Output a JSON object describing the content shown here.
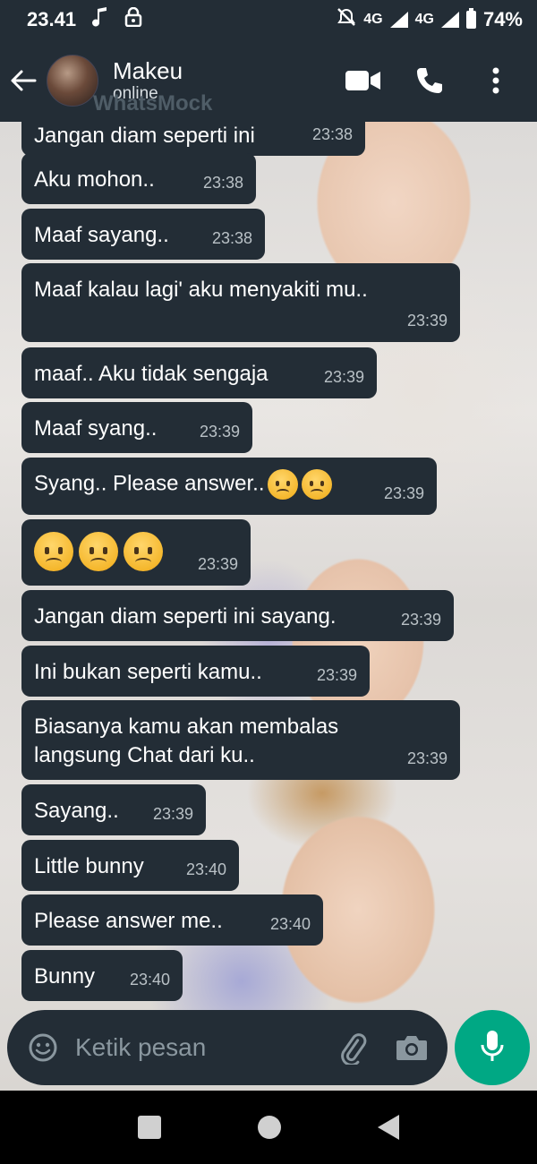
{
  "status_bar": {
    "time": "23.41",
    "network_1": "4G",
    "network_2": "4G",
    "network_2_sup": "4G",
    "battery": "74%",
    "icons": [
      "music-note-icon",
      "lock-icon",
      "mute-icon",
      "signal-icon",
      "battery-icon"
    ]
  },
  "header": {
    "contact_name": "Makeu",
    "contact_status": "online",
    "watermark": "WhatsMock",
    "icons": [
      "back-arrow-icon",
      "video-call-icon",
      "phone-call-icon",
      "more-vertical-icon"
    ]
  },
  "messages": [
    {
      "text": "Jangan diam seperti ini",
      "time": "23:38"
    },
    {
      "text": "Aku mohon..",
      "time": "23:38"
    },
    {
      "text": "Maaf sayang..",
      "time": "23:38"
    },
    {
      "text": "Maaf kalau lagi' aku menyakiti mu..",
      "time": "23:39"
    },
    {
      "text": "maaf.. Aku tidak sengaja",
      "time": "23:39"
    },
    {
      "text": "Maaf syang..",
      "time": "23:39"
    },
    {
      "text": "Syang.. Please answer..",
      "time": "23:39",
      "emoji_count": 2,
      "emoji": "worried-face-emoji"
    },
    {
      "text": "",
      "time": "23:39",
      "emoji_count": 3,
      "emoji": "worried-face-emoji"
    },
    {
      "text": "Jangan diam seperti ini sayang.",
      "time": "23:39"
    },
    {
      "text": "Ini bukan seperti kamu..",
      "time": "23:39"
    },
    {
      "text": "Biasanya kamu akan membalas langsung Chat dari ku..",
      "time": "23:39"
    },
    {
      "text": "Sayang..",
      "time": "23:39"
    },
    {
      "text": "Little bunny",
      "time": "23:40"
    },
    {
      "text": "Please answer me..",
      "time": "23:40"
    },
    {
      "text": "Bunny",
      "time": "23:40"
    }
  ],
  "input": {
    "placeholder": "Ketik pesan",
    "icons": [
      "emoji-icon",
      "attach-icon",
      "camera-icon",
      "mic-icon"
    ]
  },
  "colors": {
    "bar_bg": "#232d36",
    "bubble_bg": "#232d36",
    "accent": "#00a884"
  }
}
